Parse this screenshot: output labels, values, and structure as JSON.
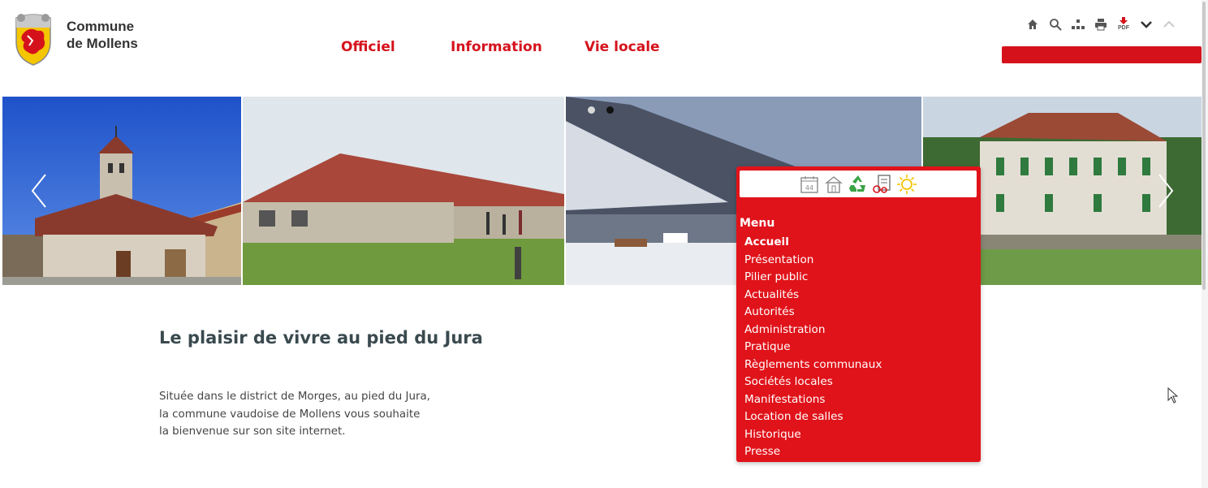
{
  "brand": {
    "line1": "Commune",
    "line2": "de Mollens"
  },
  "nav": [
    {
      "label": "Officiel"
    },
    {
      "label": "Information"
    },
    {
      "label": "Vie locale"
    }
  ],
  "toolbar": {
    "icons": [
      "home-icon",
      "search-icon",
      "sitemap-icon",
      "print-icon",
      "pdf-icon",
      "chevron-down-icon",
      "chevron-up-icon"
    ],
    "pdf_label": "PDF"
  },
  "slider": {
    "slides": 4,
    "active_dot": 1,
    "dot_count": 2
  },
  "content": {
    "headline": "Le plaisir de vivre au pied du Jura",
    "intro_lines": [
      "Située dans le district de Morges, au pied du Jura,",
      "la commune vaudoise de Mollens vous souhaite",
      "la bienvenue sur son site internet."
    ]
  },
  "menu": {
    "title": "Menu",
    "quick_icons": [
      "calendar-44-icon",
      "house-icon",
      "recycling-icon",
      "agriculture-form-icon",
      "sun-icon"
    ],
    "calendar_day": "44",
    "items": [
      {
        "label": "Accueil",
        "active": true
      },
      {
        "label": "Présentation"
      },
      {
        "label": "Pilier public"
      },
      {
        "label": "Actualités"
      },
      {
        "label": "Autorités"
      },
      {
        "label": "Administration"
      },
      {
        "label": "Pratique"
      },
      {
        "label": "Règlements communaux"
      },
      {
        "label": "Sociétés locales"
      },
      {
        "label": "Manifestations"
      },
      {
        "label": "Location de salles"
      },
      {
        "label": "Historique"
      },
      {
        "label": "Presse"
      }
    ]
  },
  "colors": {
    "accent": "#d5121c",
    "menu_bg": "#e0131a",
    "text_dark": "#3a4a4f"
  }
}
